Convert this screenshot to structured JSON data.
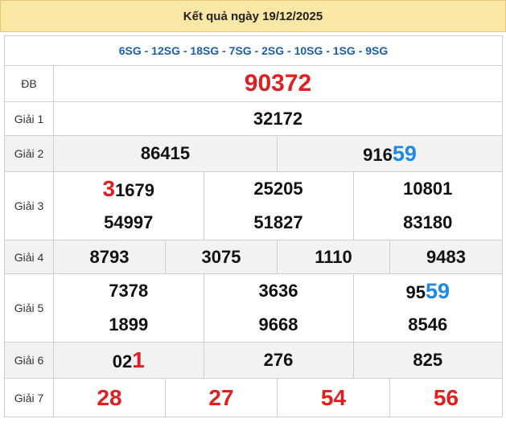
{
  "header": {
    "title": "Kết quả ngày 19/12/2025"
  },
  "codes": "6SG - 12SG - 18SG - 7SG - 2SG - 10SG - 1SG - 9SG",
  "colors": {
    "header_bg": "#fbe7a5",
    "red": "#e02020",
    "blue": "#1e88e5",
    "code_blue": "#1d5fa8",
    "row_gray": "#f2f2f2"
  },
  "prizes": {
    "db": {
      "label": "ĐB",
      "value": "90372"
    },
    "g1": {
      "label": "Giải 1",
      "value": "32172"
    },
    "g2": {
      "label": "Giải 2",
      "v1": "86415",
      "v2_head": "916",
      "v2_tail": "59"
    },
    "g3": {
      "label": "Giải 3",
      "r1": [
        {
          "head": "3",
          "tail": "1679"
        },
        "25205",
        "10801"
      ],
      "r2": [
        "54997",
        "51827",
        "83180"
      ]
    },
    "g4": {
      "label": "Giải 4",
      "values": [
        "8793",
        "3075",
        "1110",
        "9483"
      ]
    },
    "g5": {
      "label": "Giải 5",
      "r1": [
        "7378",
        "3636",
        {
          "head": "95",
          "tail": "59"
        }
      ],
      "r2": [
        "1899",
        "9668",
        "8546"
      ]
    },
    "g6": {
      "label": "Giải 6",
      "v1_head": "02",
      "v1_tail": "1",
      "v2": "276",
      "v3": "825"
    },
    "g7": {
      "label": "Giải 7",
      "values": [
        "28",
        "27",
        "54",
        "56"
      ]
    }
  }
}
